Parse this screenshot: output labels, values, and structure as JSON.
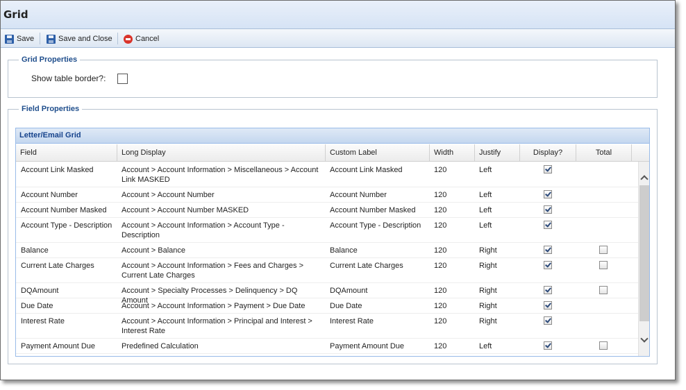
{
  "window": {
    "title": "Grid"
  },
  "toolbar": {
    "save_label": "Save",
    "save_close_label": "Save and Close",
    "cancel_label": "Cancel"
  },
  "grid_properties": {
    "legend": "Grid Properties",
    "show_border_label": "Show table border?:",
    "show_border_checked": false
  },
  "field_properties": {
    "legend": "Field Properties"
  },
  "grid": {
    "title": "Letter/Email Grid",
    "columns": [
      "Field",
      "Long Display",
      "Custom Label",
      "Width",
      "Justify",
      "Display?",
      "Total"
    ],
    "rows": [
      {
        "field": "Account Link Masked",
        "long_display": "Account > Account Information > Miscellaneous > Account Link MASKED",
        "custom_label": "Account Link Masked",
        "width": "120",
        "justify": "Left",
        "display": true,
        "total": null
      },
      {
        "field": "Account Number",
        "long_display": "Account > Account Number",
        "custom_label": "Account Number",
        "width": "120",
        "justify": "Left",
        "display": true,
        "total": null
      },
      {
        "field": "Account Number Masked",
        "long_display": "Account > Account Number MASKED",
        "custom_label": "Account Number Masked",
        "width": "120",
        "justify": "Left",
        "display": true,
        "total": null
      },
      {
        "field": "Account Type - Description",
        "long_display": "Account > Account Information > Account Type - Description",
        "custom_label": "Account Type - Description",
        "width": "120",
        "justify": "Left",
        "display": true,
        "total": null
      },
      {
        "field": "Balance",
        "long_display": "Account > Balance",
        "custom_label": "Balance",
        "width": "120",
        "justify": "Right",
        "display": true,
        "total": false
      },
      {
        "field": "Current Late Charges",
        "long_display": "Account > Account Information > Fees and Charges > Current Late Charges",
        "custom_label": "Current Late Charges",
        "width": "120",
        "justify": "Right",
        "display": true,
        "total": false
      },
      {
        "field": "DQAmount",
        "long_display": "Account > Specialty Processes > Delinquency > DQ Amount",
        "custom_label": "DQAmount",
        "width": "120",
        "justify": "Right",
        "display": true,
        "total": false
      },
      {
        "field": "Due Date",
        "long_display": "Account > Account Information > Payment > Due Date",
        "custom_label": "Due Date",
        "width": "120",
        "justify": "Right",
        "display": true,
        "total": null
      },
      {
        "field": "Interest Rate",
        "long_display": "Account > Account Information > Principal and Interest > Interest Rate",
        "custom_label": "Interest Rate",
        "width": "120",
        "justify": "Right",
        "display": true,
        "total": null
      },
      {
        "field": "Payment Amount Due",
        "long_display": "Predefined Calculation",
        "custom_label": "Payment Amount Due",
        "width": "120",
        "justify": "Left",
        "display": true,
        "total": false
      }
    ]
  },
  "icons": {
    "save": "floppy-disk-icon",
    "save_close": "floppy-disk-icon",
    "cancel": "cancel-circle-icon"
  }
}
